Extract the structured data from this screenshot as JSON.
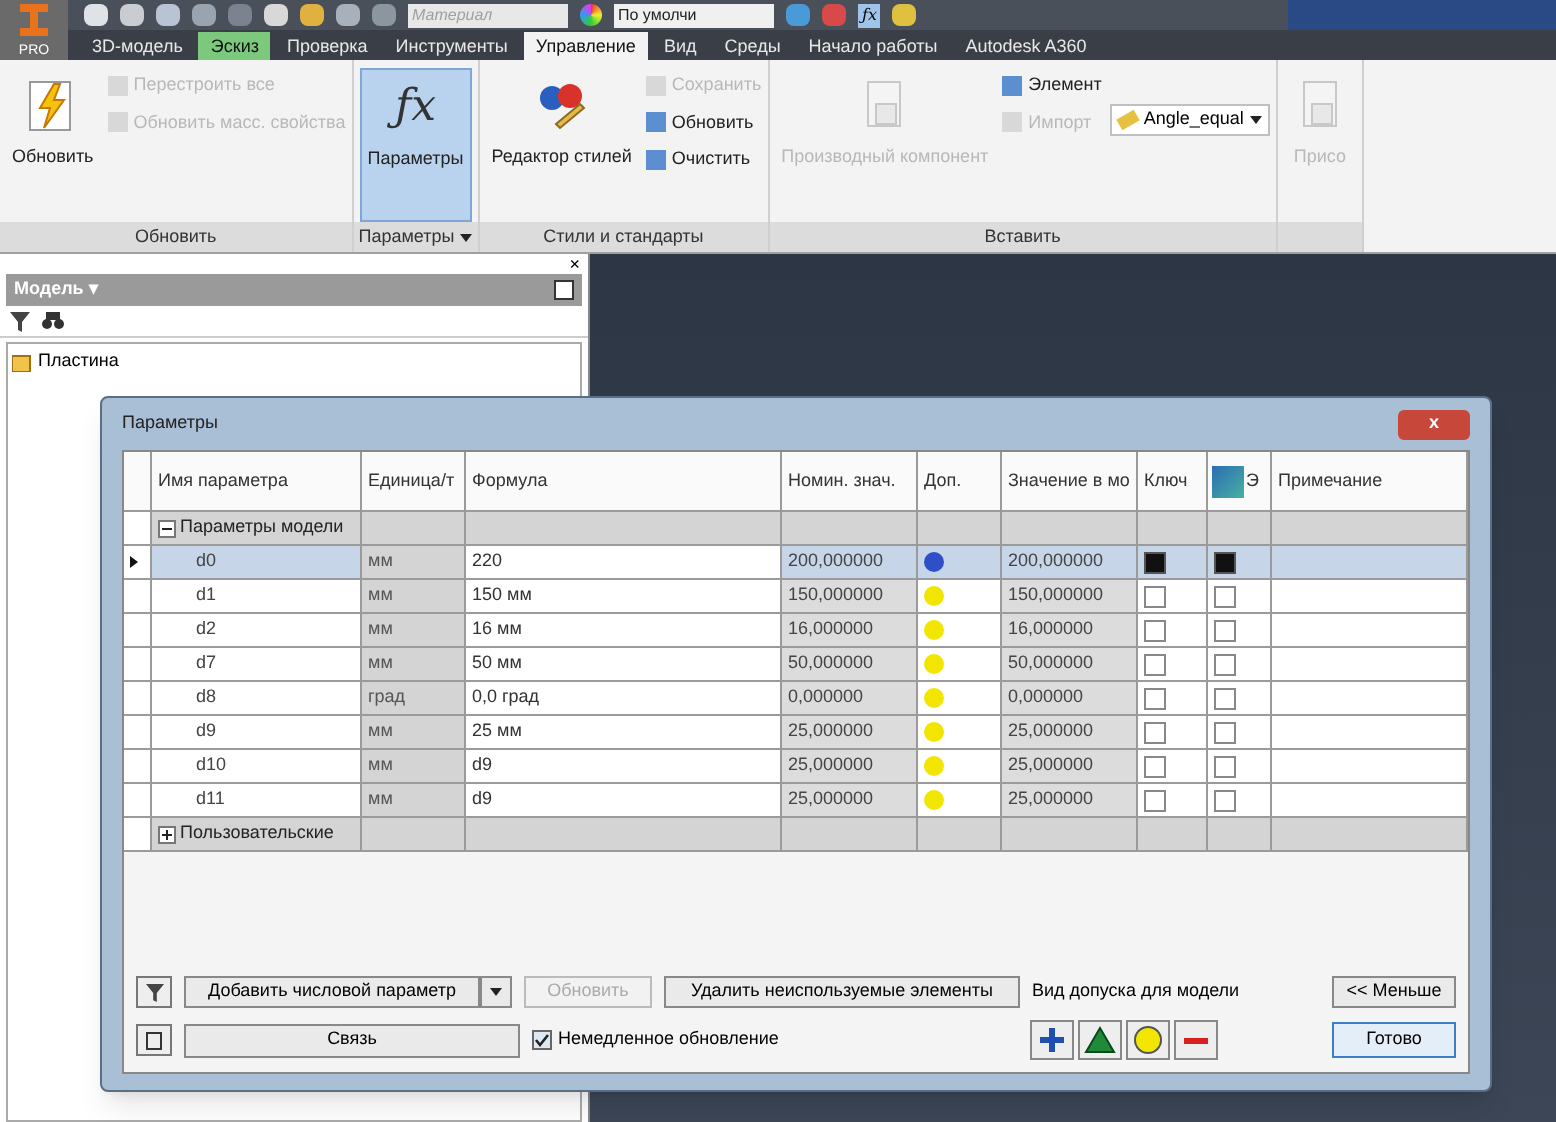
{
  "app_button": {
    "label": "PRO"
  },
  "quick_access": {
    "material": {
      "placeholder": "Материал"
    },
    "appearance": {
      "value": "По умолчи"
    },
    "fx_button": "ƒx"
  },
  "tabs": [
    {
      "label": "3D-модель",
      "selected": false,
      "contextual": false
    },
    {
      "label": "Эскиз",
      "selected": false,
      "contextual": true
    },
    {
      "label": "Проверка",
      "selected": false,
      "contextual": false
    },
    {
      "label": "Инструменты",
      "selected": false,
      "contextual": false
    },
    {
      "label": "Управление",
      "selected": true,
      "contextual": false
    },
    {
      "label": "Вид",
      "selected": false,
      "contextual": false
    },
    {
      "label": "Среды",
      "selected": false,
      "contextual": false
    },
    {
      "label": "Начало работы",
      "selected": false,
      "contextual": false
    },
    {
      "label": "Autodesk A360",
      "selected": false,
      "contextual": false
    }
  ],
  "ribbon": [
    {
      "title": "Обновить",
      "has_menu": false,
      "large": [
        {
          "label": "Обновить",
          "disabled": false,
          "selected": false,
          "kind": "update"
        }
      ],
      "small": [
        {
          "label": "Перестроить все",
          "disabled": true
        },
        {
          "label": "Обновить масс. свойства",
          "disabled": true
        }
      ]
    },
    {
      "title": "Параметры",
      "has_menu": true,
      "large": [
        {
          "label": "Параметры",
          "disabled": false,
          "selected": true,
          "kind": "fx",
          "glyph": "ƒx"
        }
      ]
    },
    {
      "title": "Стили и стандарты",
      "has_menu": false,
      "large": [
        {
          "label": "Редактор стилей",
          "disabled": false,
          "selected": false,
          "kind": "styles"
        }
      ],
      "small": [
        {
          "label": "Сохранить",
          "disabled": true
        },
        {
          "label": "Обновить",
          "disabled": false
        },
        {
          "label": "Очистить",
          "disabled": false
        }
      ]
    },
    {
      "title": "Вставить",
      "has_menu": false,
      "large": [
        {
          "label": "Производный компонент",
          "disabled": true,
          "selected": false,
          "kind": "derived"
        }
      ],
      "small": [
        {
          "label": "Элемент",
          "disabled": false
        },
        {
          "label": "Импорт",
          "disabled": true
        }
      ],
      "dropdown": {
        "value": "Angle_equal"
      }
    },
    {
      "has_menu": false,
      "large": [
        {
          "label": "Присо",
          "disabled": true,
          "selected": false,
          "kind": "derived"
        }
      ]
    }
  ],
  "browser": {
    "close": "×",
    "title": "Модель ▾",
    "tree_root": "Пластина"
  },
  "dialog": {
    "title": "Параметры",
    "close": "x",
    "columns": [
      "Имя параметра",
      "Единица/т",
      "Формула",
      "Номин. знач.",
      "Доп.",
      "Значение в мо",
      "Ключ",
      "Э",
      "Примечание"
    ],
    "groups": [
      {
        "label": "Параметры модели",
        "expanded": true,
        "rows": [
          {
            "name": "d0",
            "unit": "мм",
            "formula": "220",
            "nominal": "200,000000",
            "color": "#2f4fc8",
            "model_value": "200,000000",
            "key": true,
            "export": true,
            "selected": true
          },
          {
            "name": "d1",
            "unit": "мм",
            "formula": "150 мм",
            "nominal": "150,000000",
            "color": "#f2e600",
            "model_value": "150,000000",
            "key": false,
            "export": false,
            "selected": false
          },
          {
            "name": "d2",
            "unit": "мм",
            "formula": "16 мм",
            "nominal": "16,000000",
            "color": "#f2e600",
            "model_value": "16,000000",
            "key": false,
            "export": false,
            "selected": false
          },
          {
            "name": "d7",
            "unit": "мм",
            "formula": "50 мм",
            "nominal": "50,000000",
            "color": "#f2e600",
            "model_value": "50,000000",
            "key": false,
            "export": false,
            "selected": false
          },
          {
            "name": "d8",
            "unit": "град",
            "formula": "0,0 град",
            "nominal": "0,000000",
            "color": "#f2e600",
            "model_value": "0,000000",
            "key": false,
            "export": false,
            "selected": false
          },
          {
            "name": "d9",
            "unit": "мм",
            "formula": "25 мм",
            "nominal": "25,000000",
            "color": "#f2e600",
            "model_value": "25,000000",
            "key": false,
            "export": false,
            "selected": false
          },
          {
            "name": "d10",
            "unit": "мм",
            "formula": "d9",
            "nominal": "25,000000",
            "color": "#f2e600",
            "model_value": "25,000000",
            "key": false,
            "export": false,
            "selected": false
          },
          {
            "name": "d11",
            "unit": "мм",
            "formula": "d9",
            "nominal": "25,000000",
            "color": "#f2e600",
            "model_value": "25,000000",
            "key": false,
            "export": false,
            "selected": false
          }
        ]
      },
      {
        "label": "Пользовательские",
        "expanded": false
      }
    ],
    "add_button": "Добавить числовой параметр",
    "update_button": {
      "label": "Обновить",
      "disabled": true
    },
    "purge_button": "Удалить неиспользуемые элементы",
    "tolerance_label": "Вид допуска для модели",
    "less_button": "<< Меньше",
    "link_button": "Связь",
    "immediate_update": {
      "label": "Немедленное обновление",
      "checked": true
    },
    "done_button": "Готово"
  }
}
